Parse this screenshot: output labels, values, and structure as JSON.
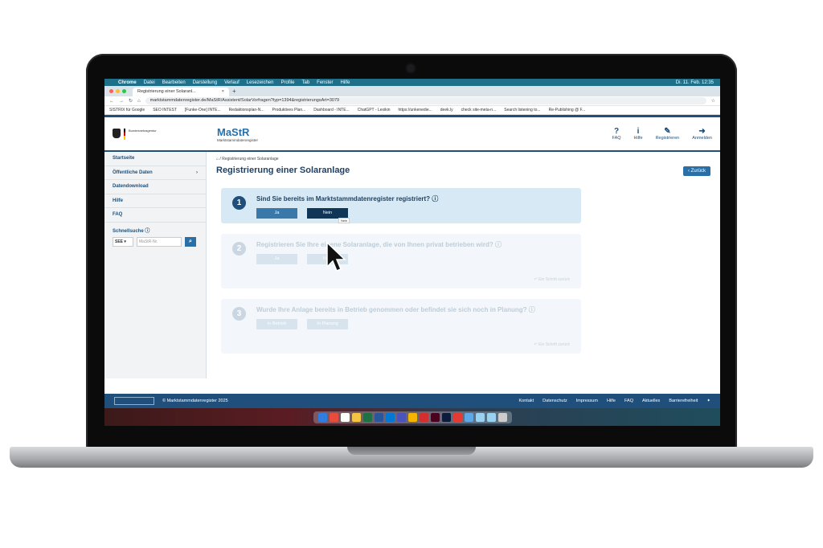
{
  "mac_menu": {
    "apple": "",
    "items": [
      "Chrome",
      "Datei",
      "Bearbeiten",
      "Darstellung",
      "Verlauf",
      "Lesezeichen",
      "Profile",
      "Tab",
      "Fenster",
      "Hilfe"
    ],
    "clock": "Di. 11. Feb. 12:35"
  },
  "browser": {
    "tab_title": "Registrierung einer Solaranl...",
    "tab_close": "×",
    "new_tab": "+",
    "url": "marktstammdatenregister.de/MaStR/Assistent/SolarVorfragen?typ=1394&registrierungsArt=3079",
    "bookmarks": [
      "SISTRIX für Google",
      "SEO INTEST",
      "[Funke-One] INTE...",
      "Redaktionsplan-N...",
      "Produktives Plan...",
      "Dashboard - INTE...",
      "ChatGPT - Lexikin",
      "https://unkenedie...",
      "deek.ly",
      "check site-meta-n...",
      "Search listening to...",
      "Re-Publishing @ F..."
    ]
  },
  "header": {
    "gov_text": "Bundesnetzagentur",
    "brand_name": "MaStR",
    "brand_sub": "Marktstammdatenregister",
    "nav": [
      {
        "icon": "?",
        "label": "FAQ"
      },
      {
        "icon": "i",
        "label": "Hilfe"
      },
      {
        "icon": "✎",
        "label": "Registrieren"
      },
      {
        "icon": "➜",
        "label": "Anmelden"
      }
    ]
  },
  "sidebar": {
    "items": [
      {
        "label": "Startseite",
        "arrow": ""
      },
      {
        "label": "Öffentliche Daten",
        "arrow": "›"
      },
      {
        "label": "Datendownload",
        "arrow": ""
      },
      {
        "label": "Hilfe",
        "arrow": ""
      },
      {
        "label": "FAQ",
        "arrow": ""
      }
    ],
    "quick_search_label": "Schnellsuche",
    "quick_select": "SEE ▾",
    "quick_placeholder": "MaStR-Nr."
  },
  "main": {
    "breadcrumb": "Registrierung einer Solaranlage",
    "title": "Registrierung einer Solaranlage",
    "back_label": "‹ Zurück",
    "steps": [
      {
        "num": "1",
        "question": "Sind Sie bereits im Marktstammdatenregister registriert?",
        "buttons": [
          "Ja",
          "Nein"
        ],
        "back": ""
      },
      {
        "num": "2",
        "question": "Registrieren Sie Ihre eigene Solaranlage, die von Ihnen privat betrieben wird?",
        "buttons": [
          "Ja",
          "Nein"
        ],
        "back": "↶ Ein Schritt zurück"
      },
      {
        "num": "3",
        "question": "Wurde Ihre Anlage bereits in Betrieb genommen oder befindet sie sich noch in Planung?",
        "buttons": [
          "In Betrieb",
          "In Planung"
        ],
        "back": "↶ Ein Schritt zurück"
      }
    ],
    "tooltip": "Nein"
  },
  "footer": {
    "copyright": "© Marktstammdatenregister 2025",
    "links": [
      "Kontakt",
      "Datenschutz",
      "Impressum",
      "Hilfe",
      "FAQ",
      "Aktuelles",
      "Barrierefreiheit"
    ]
  }
}
